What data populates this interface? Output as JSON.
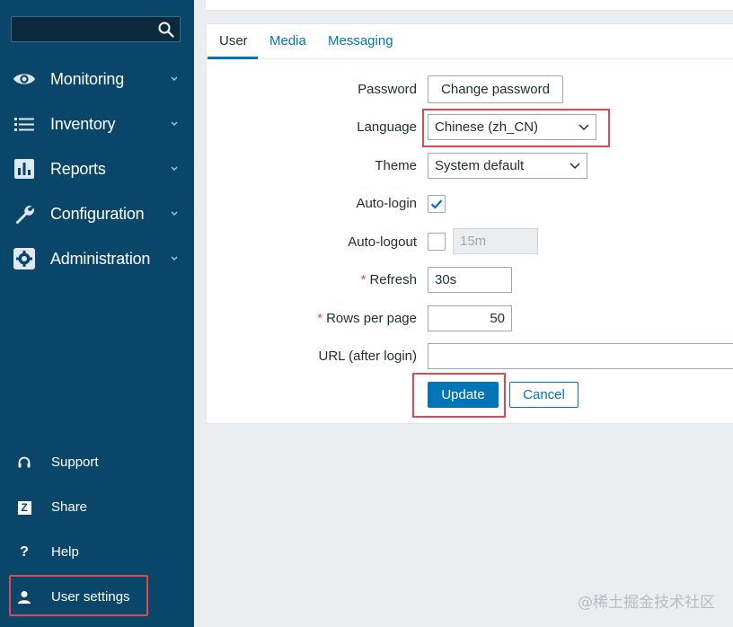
{
  "sidebar": {
    "search": {
      "placeholder": "",
      "value": ""
    },
    "nav": [
      {
        "label": "Monitoring",
        "icon": "eye-icon"
      },
      {
        "label": "Inventory",
        "icon": "list-icon"
      },
      {
        "label": "Reports",
        "icon": "bar-chart-icon"
      },
      {
        "label": "Configuration",
        "icon": "wrench-icon"
      },
      {
        "label": "Administration",
        "icon": "gear-icon"
      }
    ],
    "bottom": [
      {
        "label": "Support",
        "icon": "headset-icon"
      },
      {
        "label": "Share",
        "icon": "share-z-icon",
        "glyph": "Z"
      },
      {
        "label": "Help",
        "icon": "help-icon",
        "glyph": "?"
      },
      {
        "label": "User settings",
        "icon": "user-icon"
      }
    ]
  },
  "tabs": [
    {
      "label": "User",
      "active": true
    },
    {
      "label": "Media",
      "active": false
    },
    {
      "label": "Messaging",
      "active": false
    }
  ],
  "form": {
    "password": {
      "label": "Password",
      "button": "Change password"
    },
    "language": {
      "label": "Language",
      "value": "Chinese (zh_CN)"
    },
    "theme": {
      "label": "Theme",
      "value": "System default"
    },
    "autologin": {
      "label": "Auto-login",
      "checked": true
    },
    "autologout": {
      "label": "Auto-logout",
      "checked": false,
      "value": "15m"
    },
    "refresh": {
      "label": "Refresh",
      "required_mark": "*",
      "value": "30s"
    },
    "rows_per_page": {
      "label": "Rows per page",
      "required_mark": "*",
      "value": "50"
    },
    "url_after_login": {
      "label": "URL (after login)",
      "value": ""
    },
    "update_label": "Update",
    "cancel_label": "Cancel"
  },
  "watermark": "@稀土掘金技术社区",
  "colors": {
    "sidebar_bg": "#0a466a",
    "accent": "#0275b8",
    "highlight": "#e0484d",
    "page_bg": "#ebeef0"
  }
}
